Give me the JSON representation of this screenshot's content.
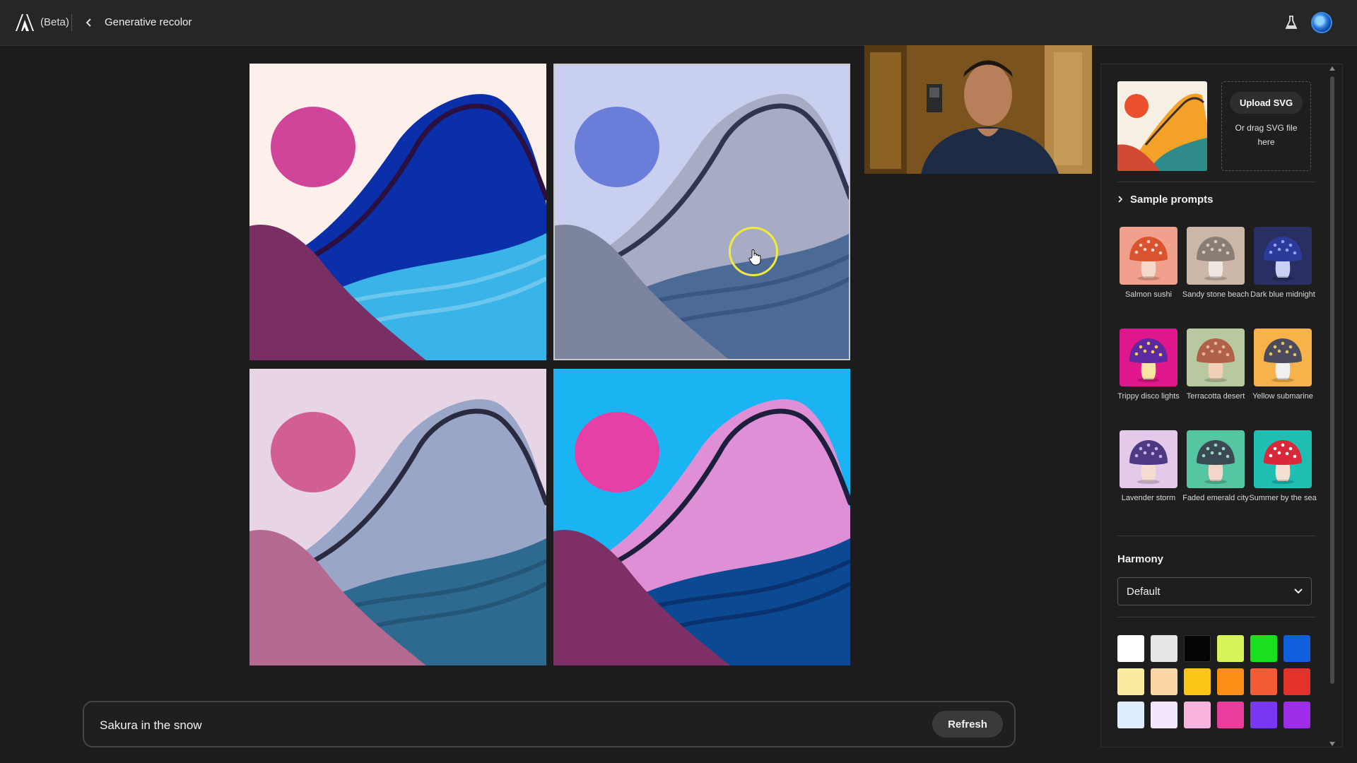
{
  "header": {
    "beta_label": "(Beta)",
    "title": "Generative recolor",
    "back_icon": "chevron-left-icon",
    "lab_icon": "flask-icon"
  },
  "canvas": {
    "variations": [
      {
        "bg": "#fdf0ea",
        "sun": "#d0459a",
        "mountain": "#0b2fa8",
        "ridge": "#2a1040",
        "water": "#3ab3e8",
        "wave": "#6cc7ee",
        "hill": "#7a2f64"
      },
      {
        "bg": "#c9cfee",
        "sun": "#6a7ed9",
        "mountain": "#a7acc4",
        "ridge": "#2f3550",
        "water": "#4b6b96",
        "wave": "#3b5682",
        "hill": "#7d849e"
      },
      {
        "bg": "#e7d5e6",
        "sun": "#d15f94",
        "mountain": "#9aa6c8",
        "ridge": "#2a2b40",
        "water": "#2e6a90",
        "wave": "#245677",
        "hill": "#b46a90"
      },
      {
        "bg": "#19b4f1",
        "sun": "#e63fa6",
        "mountain": "#df8fd6",
        "ridge": "#1b1f3b",
        "water": "#0b4a93",
        "wave": "#0a3170",
        "hill": "#7e2f66"
      }
    ]
  },
  "prompt": {
    "value": "Sakura in the snow",
    "refresh_label": "Refresh"
  },
  "panel": {
    "upload_button": "Upload SVG",
    "upload_hint": "Or drag SVG file here",
    "sample_prompts_title": "Sample prompts",
    "samples": [
      {
        "label": "Salmon sushi",
        "bg": "#f2a08e",
        "cap": "#d9532f",
        "stem": "#f3d9c9",
        "dots": "#f8d4c6"
      },
      {
        "label": "Sandy stone beach",
        "bg": "#cbb6a8",
        "cap": "#8a7d74",
        "stem": "#efe6df",
        "dots": "#d8cbc0"
      },
      {
        "label": "Dark blue midnight",
        "bg": "#2a2f63",
        "cap": "#2c3a9a",
        "stem": "#c9d2f2",
        "dots": "#8fa3f0"
      },
      {
        "label": "Trippy disco lights",
        "bg": "#e0168c",
        "cap": "#5b2aa0",
        "stem": "#f8e6a0",
        "dots": "#f7d043"
      },
      {
        "label": "Terracotta desert",
        "bg": "#b8c9a2",
        "cap": "#b0614a",
        "stem": "#f2d1b8",
        "dots": "#e9b59a"
      },
      {
        "label": "Yellow submarine",
        "bg": "#f8b24a",
        "cap": "#4c4b5b",
        "stem": "#eef0f2",
        "dots": "#e2c660"
      },
      {
        "label": "Lavender storm",
        "bg": "#e4c9ea",
        "cap": "#4e3a82",
        "stem": "#f6dcd0",
        "dots": "#c6b4ee"
      },
      {
        "label": "Faded emerald city",
        "bg": "#56c5a2",
        "cap": "#3b4a52",
        "stem": "#f2d6c8",
        "dots": "#9ed8c8"
      },
      {
        "label": "Summer by the sea",
        "bg": "#1ebfb2",
        "cap": "#d8283a",
        "stem": "#f3e0cf",
        "dots": "#ffffff"
      }
    ],
    "harmony_title": "Harmony",
    "harmony_value": "Default",
    "colors": [
      "#ffffff",
      "#e6e6e6",
      "#050505",
      "#d7f35a",
      "#19e01e",
      "#0f5fde",
      "#f9ec9f",
      "#fcd7a6",
      "#fbc515",
      "#fb8e16",
      "#f45c36",
      "#e4322a",
      "#dfeefe",
      "#f3e8fb",
      "#f9b3de",
      "#ea3c9c",
      "#7a36f2",
      "#9d2de8"
    ]
  }
}
